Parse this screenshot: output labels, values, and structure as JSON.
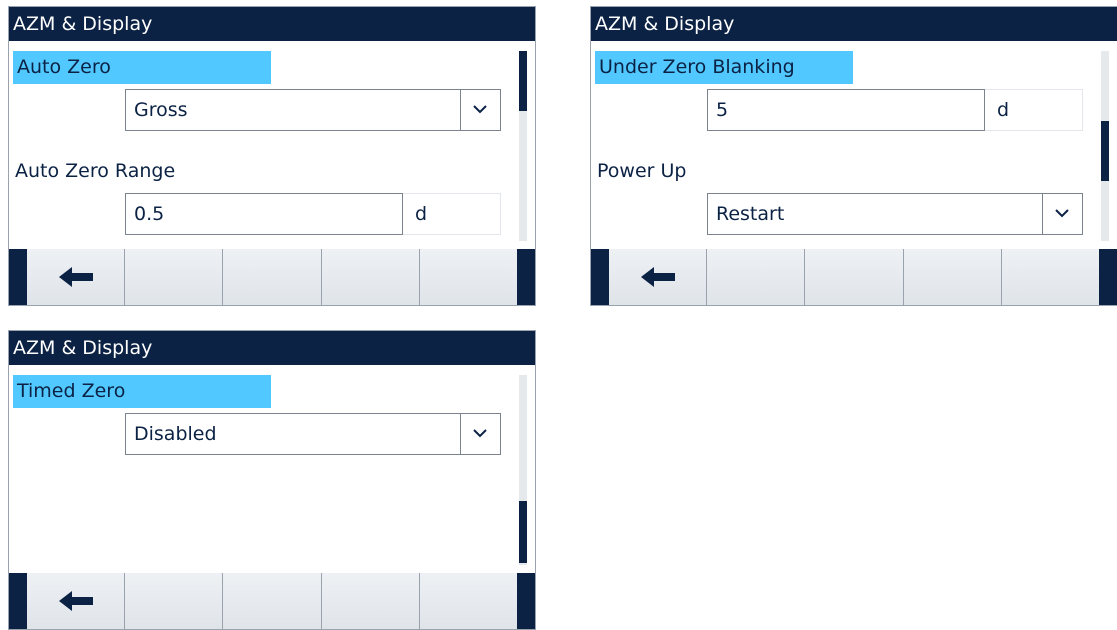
{
  "panels": [
    {
      "title": "AZM & Display",
      "fields": {
        "auto_zero_label": "Auto Zero",
        "auto_zero_value": "Gross",
        "auto_zero_range_label": "Auto Zero Range",
        "auto_zero_range_value": "0.5",
        "auto_zero_range_unit": "d"
      },
      "softkeys": [
        "back-icon",
        "",
        "",
        "",
        ""
      ]
    },
    {
      "title": "AZM & Display",
      "fields": {
        "under_zero_blanking_label": "Under Zero Blanking",
        "under_zero_blanking_value": "5",
        "under_zero_blanking_unit": "d",
        "power_up_label": "Power Up",
        "power_up_value": "Restart"
      },
      "softkeys": [
        "back-icon",
        "",
        "",
        "",
        ""
      ]
    },
    {
      "title": "AZM & Display",
      "fields": {
        "timed_zero_label": "Timed Zero",
        "timed_zero_value": "Disabled"
      },
      "softkeys": [
        "back-icon",
        "",
        "",
        "",
        ""
      ]
    }
  ],
  "colors": {
    "title_bar": "#0b2244",
    "highlight": "#51c8ff",
    "softkey_face": "#e6eaee"
  }
}
